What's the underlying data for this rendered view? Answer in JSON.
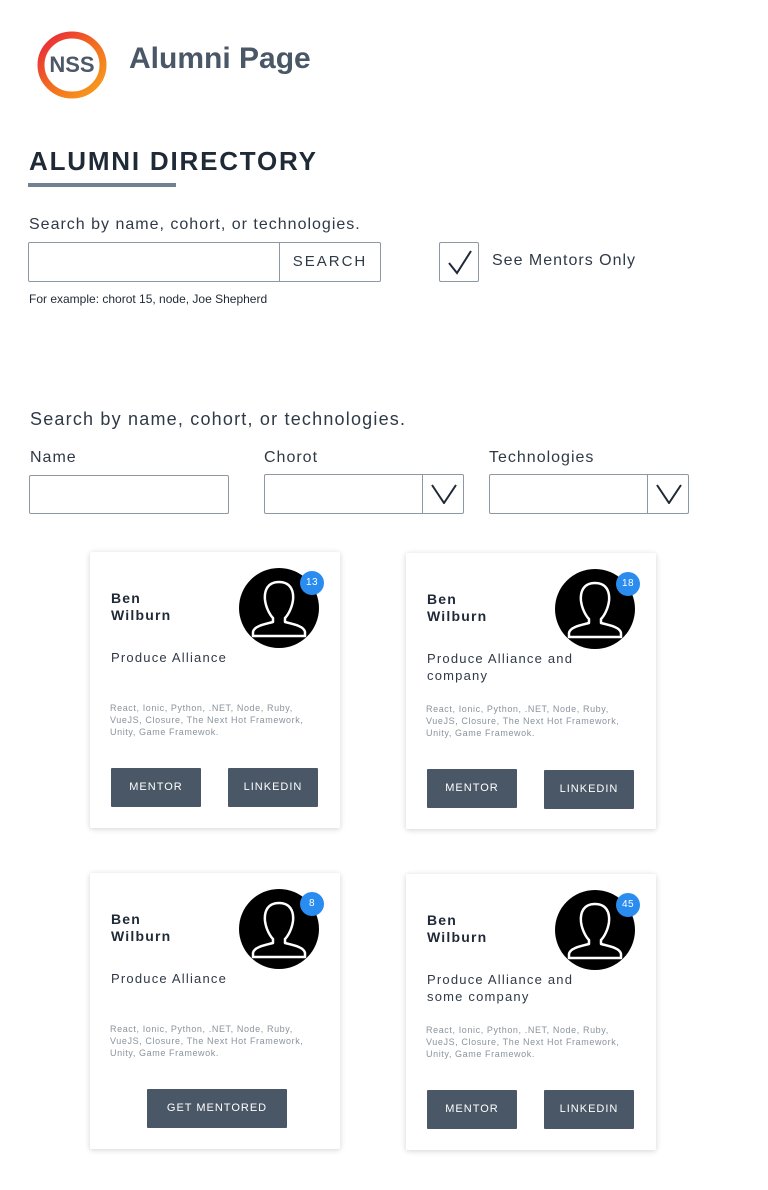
{
  "header": {
    "logo_text": "NSS",
    "title": "Alumni Page"
  },
  "directory": {
    "title": "ALUMNI DIRECTORY",
    "search_caption": "Search by name, cohort, or technologies.",
    "search_value": "",
    "search_button": "SEARCH",
    "example": "For example: chorot 15, node, Joe Shepherd",
    "mentors_only_label": "See Mentors Only",
    "mentors_only_checked": true
  },
  "filters": {
    "caption": "Search by name, cohort, or technologies.",
    "name_label": "Name",
    "name_value": "",
    "cohort_label": "Chorot",
    "cohort_value": "",
    "tech_label": "Technologies",
    "tech_value": ""
  },
  "cards": [
    {
      "first": "Ben",
      "last": "Wilburn",
      "badge": "13",
      "company": "Produce Alliance",
      "tech": "React, Ionic, Python, .NET, Node, Ruby, VueJS, Closure, The Next Hot Framework, Unity, Game Framewok.",
      "buttons": [
        "MENTOR",
        "LINKEDIN"
      ]
    },
    {
      "first": "Ben",
      "last": "Wilburn",
      "badge": "18",
      "company": "Produce Alliance and company",
      "tech": "React, Ionic, Python, .NET, Node, Ruby, VueJS, Closure, The Next Hot Framework, Unity, Game Framewok.",
      "buttons": [
        "MENTOR",
        "LINKEDIN"
      ]
    },
    {
      "first": "Ben",
      "last": "Wilburn",
      "badge": "8",
      "company": "Produce Alliance",
      "tech": "React, Ionic, Python, .NET, Node, Ruby, VueJS, Closure, The Next Hot Framework, Unity, Game Framewok.",
      "buttons": [
        "GET MENTORED"
      ]
    },
    {
      "first": "Ben",
      "last": "Wilburn",
      "badge": "45",
      "company": "Produce Alliance and some company",
      "tech": "React, Ionic, Python, .NET, Node, Ruby, VueJS, Closure, The Next Hot Framework, Unity, Game Framewok.",
      "buttons": [
        "MENTOR",
        "LINKEDIN"
      ]
    }
  ],
  "colors": {
    "primary": "#4a5766",
    "badge": "#2b8cf0",
    "logo_ring_start": "#f26b21",
    "logo_ring_end": "#e8233d"
  },
  "icons": {
    "avatar": "user-silhouette-icon",
    "checkbox": "checkmark-icon",
    "dropdown": "chevron-down-icon"
  }
}
